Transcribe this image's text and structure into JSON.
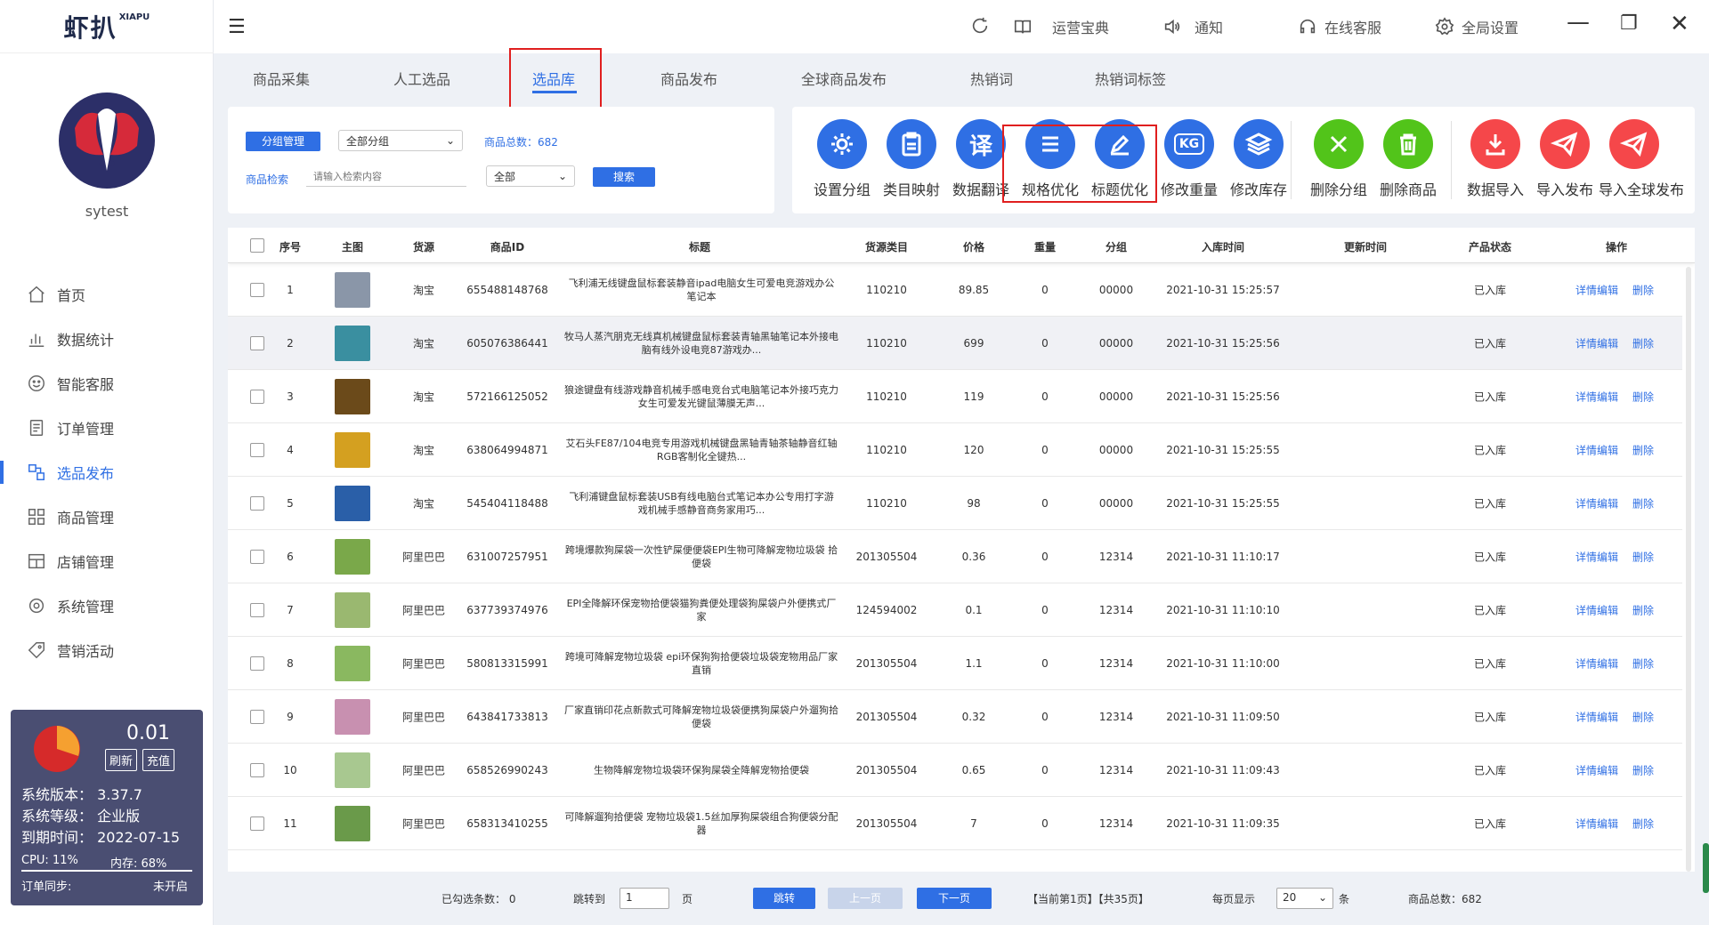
{
  "brand": {
    "name": "虾扒",
    "sup": "XIAPU"
  },
  "user": {
    "name": "sytest"
  },
  "nav": [
    {
      "label": "首页"
    },
    {
      "label": "数据统计"
    },
    {
      "label": "智能客服"
    },
    {
      "label": "订单管理"
    },
    {
      "label": "选品发布"
    },
    {
      "label": "商品管理"
    },
    {
      "label": "店铺管理"
    },
    {
      "label": "系统管理"
    },
    {
      "label": "营销活动"
    }
  ],
  "info": {
    "balance": "0.01",
    "refresh": "刷新",
    "recharge": "充值",
    "version": "系统版本： 3.37.7",
    "level": "系统等级： 企业版",
    "expire": "到期时间： 2022-07-15",
    "cpu": "CPU: 11%",
    "mem": "内存: 68%",
    "sync_label": "订单同步:",
    "sync_value": "未开启"
  },
  "topbar": {
    "guide": "运营宝典",
    "notice": "通知",
    "support": "在线客服",
    "settings": "全局设置"
  },
  "tabs": [
    "商品采集",
    "人工选品",
    "选品库",
    "商品发布",
    "全球商品发布",
    "热销词",
    "热销词标签"
  ],
  "filter": {
    "group_manage": "分组管理",
    "group_select": "全部分组",
    "total": "商品总数：682",
    "search_label": "商品检索",
    "search_placeholder": "请输入检索内容",
    "scope_select": "全部",
    "search_btn": "搜索"
  },
  "actions": [
    {
      "label": "设置分组",
      "color": "#2f6fe4",
      "icon": "gear-icon"
    },
    {
      "label": "类目映射",
      "color": "#2f6fe4",
      "icon": "clipboard-icon"
    },
    {
      "label": "数据翻译",
      "color": "#2f6fe4",
      "icon": "translate-icon",
      "glyph": "译"
    },
    {
      "label": "规格优化",
      "color": "#2f6fe4",
      "icon": "list-icon"
    },
    {
      "label": "标题优化",
      "color": "#2f6fe4",
      "icon": "edit-icon"
    },
    {
      "label": "修改重量",
      "color": "#2f6fe4",
      "icon": "weight-icon",
      "glyph": "KG"
    },
    {
      "label": "修改库存",
      "color": "#2f6fe4",
      "icon": "layers-icon"
    },
    {
      "label": "删除分组",
      "color": "#52c41a",
      "icon": "close-icon"
    },
    {
      "label": "删除商品",
      "color": "#52c41a",
      "icon": "trash-icon"
    },
    {
      "label": "数据导入",
      "color": "#f5474a",
      "icon": "download-icon"
    },
    {
      "label": "导入发布",
      "color": "#f5474a",
      "icon": "send-icon"
    },
    {
      "label": "导入全球发布",
      "color": "#f5474a",
      "icon": "send-icon"
    }
  ],
  "columns": [
    "序号",
    "主图",
    "货源",
    "商品ID",
    "标题",
    "货源类目",
    "价格",
    "重量",
    "分组",
    "入库时间",
    "更新时间",
    "产品状态",
    "操作"
  ],
  "rows": [
    {
      "no": "1",
      "source": "淘宝",
      "id": "655488148768",
      "title": "飞利浦无线键盘鼠标套装静音ipad电脑女生可爱电竞游戏办公笔记本",
      "cat": "110210",
      "price": "89.85",
      "weight": "0",
      "group": "00000",
      "time": "2021-10-31 15:25:57",
      "status": "已入库",
      "thumb": "#8a96a8"
    },
    {
      "no": "2",
      "source": "淘宝",
      "id": "605076386441",
      "title": "牧马人蒸汽朋克无线真机械键盘鼠标套装青轴黑轴笔记本外接电脑有线外设电竞87游戏办...",
      "cat": "110210",
      "price": "699",
      "weight": "0",
      "group": "00000",
      "time": "2021-10-31 15:25:56",
      "status": "已入库",
      "thumb": "#3a8fa0"
    },
    {
      "no": "3",
      "source": "淘宝",
      "id": "572166125052",
      "title": "狼途键盘有线游戏静音机械手感电竞台式电脑笔记本外接巧克力女生可爱发光键鼠薄膜无声...",
      "cat": "110210",
      "price": "119",
      "weight": "0",
      "group": "00000",
      "time": "2021-10-31 15:25:56",
      "status": "已入库",
      "thumb": "#6b4a1a"
    },
    {
      "no": "4",
      "source": "淘宝",
      "id": "638064994871",
      "title": "艾石头FE87/104电竞专用游戏机械键盘黑轴青轴茶轴静音红轴RGB客制化全键热...",
      "cat": "110210",
      "price": "120",
      "weight": "0",
      "group": "00000",
      "time": "2021-10-31 15:25:55",
      "status": "已入库",
      "thumb": "#d4a020"
    },
    {
      "no": "5",
      "source": "淘宝",
      "id": "545404118488",
      "title": "飞利浦键盘鼠标套装USB有线电脑台式笔记本办公专用打字游戏机械手感静音商务家用巧...",
      "cat": "110210",
      "price": "98",
      "weight": "0",
      "group": "00000",
      "time": "2021-10-31 15:25:55",
      "status": "已入库",
      "thumb": "#2a5fa8"
    },
    {
      "no": "6",
      "source": "阿里巴巴",
      "id": "631007257951",
      "title": "跨境爆款狗屎袋一次性铲屎便便袋EPI生物可降解宠物垃圾袋 拾便袋",
      "cat": "201305504",
      "price": "0.36",
      "weight": "0",
      "group": "12314",
      "time": "2021-10-31 11:10:17",
      "status": "已入库",
      "thumb": "#7aa84a"
    },
    {
      "no": "7",
      "source": "阿里巴巴",
      "id": "637739374976",
      "title": "EPI全降解环保宠物拾便袋猫狗粪便处理袋狗屎袋户外便携式厂家",
      "cat": "124594002",
      "price": "0.1",
      "weight": "0",
      "group": "12314",
      "time": "2021-10-31 11:10:10",
      "status": "已入库",
      "thumb": "#9ab870"
    },
    {
      "no": "8",
      "source": "阿里巴巴",
      "id": "580813315991",
      "title": "跨境可降解宠物垃圾袋 epi环保狗狗拾便袋垃圾袋宠物用品厂家直销",
      "cat": "201305504",
      "price": "1.1",
      "weight": "0",
      "group": "12314",
      "time": "2021-10-31 11:10:00",
      "status": "已入库",
      "thumb": "#8ab860"
    },
    {
      "no": "9",
      "source": "阿里巴巴",
      "id": "643841733813",
      "title": "厂家直销印花点新款式可降解宠物垃圾袋便携狗屎袋户外遛狗拾便袋",
      "cat": "201305504",
      "price": "0.32",
      "weight": "0",
      "group": "12314",
      "time": "2021-10-31 11:09:50",
      "status": "已入库",
      "thumb": "#c890b0"
    },
    {
      "no": "10",
      "source": "阿里巴巴",
      "id": "658526990243",
      "title": "生物降解宠物垃圾袋环保狗屎袋全降解宠物拾便袋",
      "cat": "201305504",
      "price": "0.65",
      "weight": "0",
      "group": "12314",
      "time": "2021-10-31 11:09:43",
      "status": "已入库",
      "thumb": "#a8c890"
    },
    {
      "no": "11",
      "source": "阿里巴巴",
      "id": "658313410255",
      "title": "可降解遛狗拾便袋 宠物垃圾袋1.5丝加厚狗屎袋组合狗便袋分配器",
      "cat": "201305504",
      "price": "7",
      "weight": "0",
      "group": "12314",
      "time": "2021-10-31 11:09:35",
      "status": "已入库",
      "thumb": "#6a9a4a"
    }
  ],
  "row_actions": {
    "edit": "详情编辑",
    "delete": "删除"
  },
  "footer": {
    "selected": "已勾选条数： 0",
    "jump_to": "跳转到",
    "page_value": "1",
    "page_unit": "页",
    "jump_btn": "跳转",
    "prev": "上一页",
    "next": "下一页",
    "page_info": "【当前第1页】【共35页】",
    "per_page_label": "每页显示",
    "per_page": "20",
    "per_page_unit": "条",
    "total": "商品总数：682"
  }
}
